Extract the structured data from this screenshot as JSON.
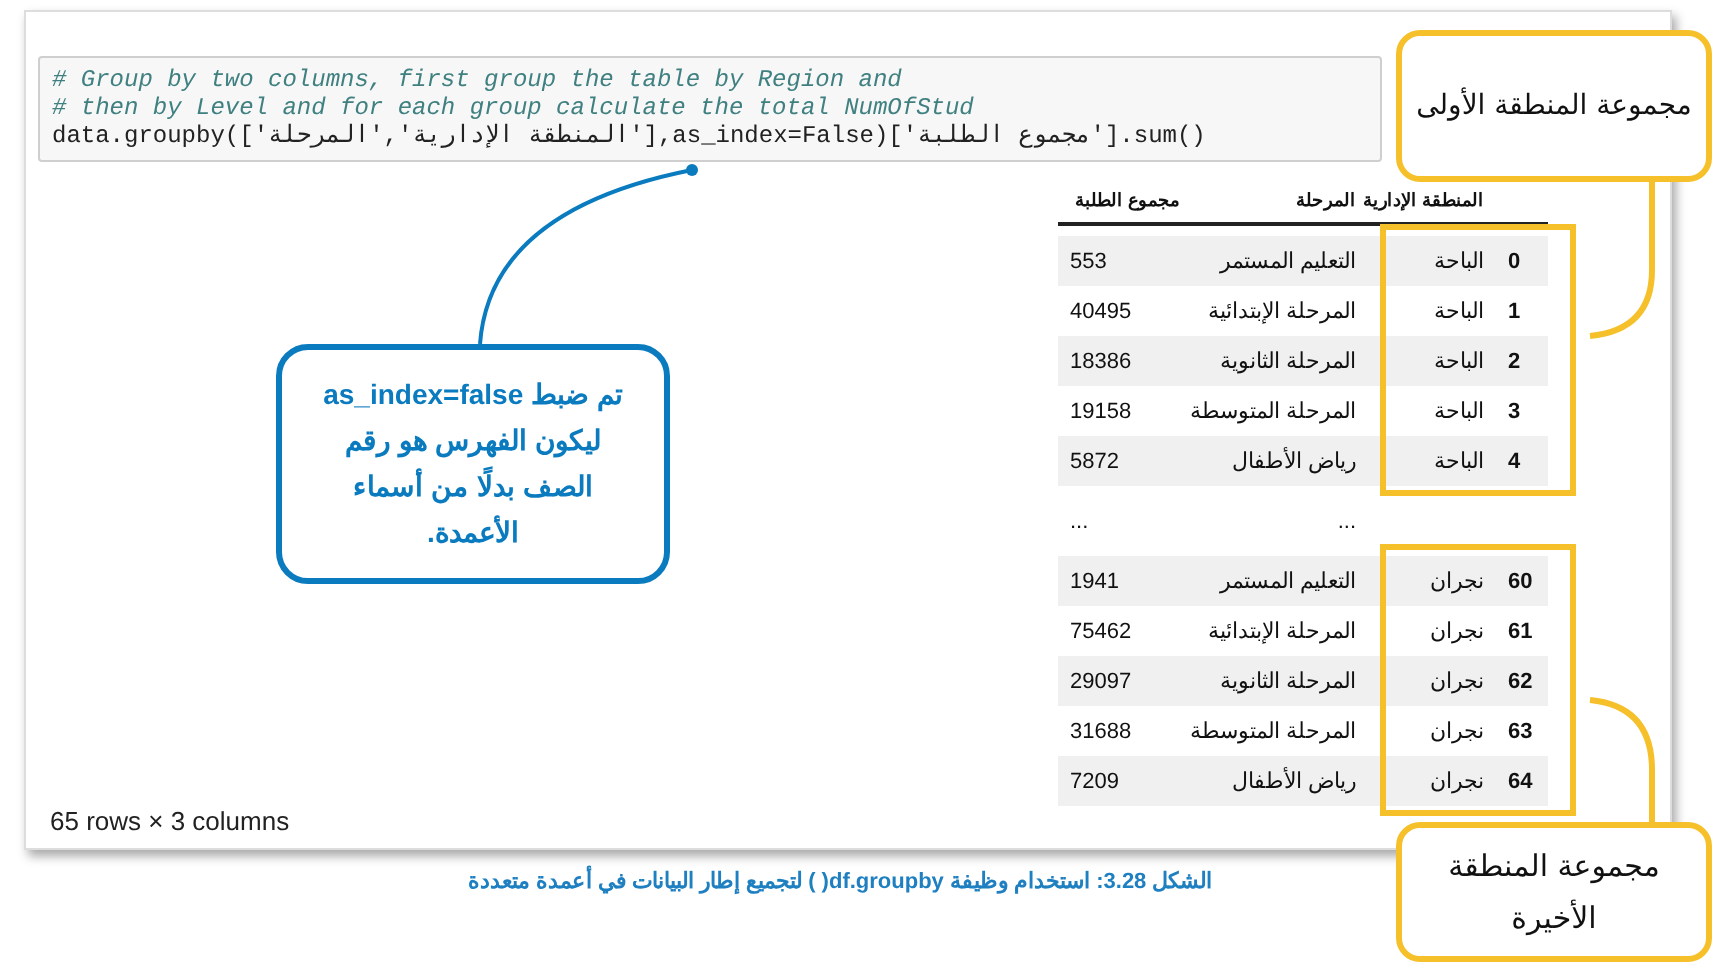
{
  "code_cell": {
    "lines": [
      [
        {
          "kind": "comment",
          "text": "# Group by two columns, first group the table by Region and"
        }
      ],
      [
        {
          "kind": "comment",
          "text": "# then by Level and for each group calculate the total NumOfStud"
        }
      ],
      [
        {
          "kind": "plain",
          "text": "data.groupby(['المنطقة الإدارية','المرحلة'],as_index=False)['مجموع الطلبة'].sum()"
        }
      ]
    ]
  },
  "table": {
    "columns": [
      "المنطقة الإدارية",
      "المرحلة",
      "مجموع الطلبة"
    ],
    "groups": [
      {
        "highlighted": true,
        "rows": [
          {
            "index": "0",
            "cells": [
              "الباحة",
              "التعليم المستمر",
              "553"
            ]
          },
          {
            "index": "1",
            "cells": [
              "الباحة",
              "المرحلة الإبتدائية",
              "40495"
            ]
          },
          {
            "index": "2",
            "cells": [
              "الباحة",
              "المرحلة الثانوية",
              "18386"
            ]
          },
          {
            "index": "3",
            "cells": [
              "الباحة",
              "المرحلة المتوسطة",
              "19158"
            ]
          },
          {
            "index": "4",
            "cells": [
              "الباحة",
              "رياض الأطفال",
              "5872"
            ]
          }
        ]
      },
      {
        "highlighted": false,
        "rows": [
          {
            "index": "",
            "cells": [
              "",
              "...",
              "..."
            ]
          }
        ]
      },
      {
        "highlighted": true,
        "rows": [
          {
            "index": "60",
            "cells": [
              "نجران",
              "التعليم المستمر",
              "1941"
            ]
          },
          {
            "index": "61",
            "cells": [
              "نجران",
              "المرحلة الإبتدائية",
              "75462"
            ]
          },
          {
            "index": "62",
            "cells": [
              "نجران",
              "المرحلة الثانوية",
              "29097"
            ]
          },
          {
            "index": "63",
            "cells": [
              "نجران",
              "المرحلة المتوسطة",
              "31688"
            ]
          },
          {
            "index": "64",
            "cells": [
              "نجران",
              "رياض الأطفال",
              "7209"
            ]
          }
        ]
      }
    ]
  },
  "shape_note": "65 rows × 3 columns",
  "callouts": [
    {
      "kind": "blue",
      "text": "تم ضبط as_index=false ليكون الفهرس هو رقم الصف بدلًا من أسماء الأعمدة."
    },
    {
      "kind": "yellow-top",
      "text": "مجموعة المنطقة الأولى"
    },
    {
      "kind": "yellow-bottom",
      "text": "مجموعة المنطقة الأخيرة"
    }
  ],
  "caption": "الشكل 3.28: استخدام وظيفة df.groupby( ) لتجميع إطار البيانات في أعمدة متعددة"
}
